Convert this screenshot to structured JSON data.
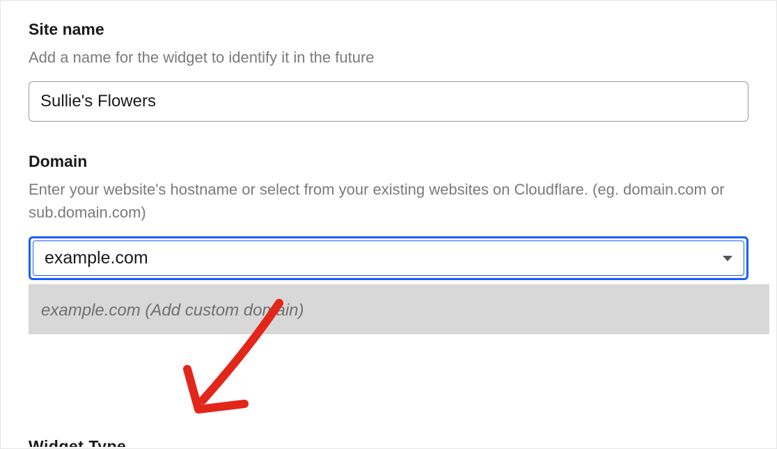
{
  "siteName": {
    "label": "Site name",
    "help": "Add a name for the widget to identify it in the future",
    "value": "Sullie's Flowers"
  },
  "domain": {
    "label": "Domain",
    "help": "Enter your website's hostname or select from your existing websites on Cloudflare. (eg. domain.com or sub.domain.com)",
    "value": "example.com",
    "dropdownOption": "example.com (Add custom domain)"
  },
  "widgetType": {
    "labelPartial": "Widget Type"
  },
  "accentColor": "#1a5cff",
  "arrowColor": "#e3261a"
}
